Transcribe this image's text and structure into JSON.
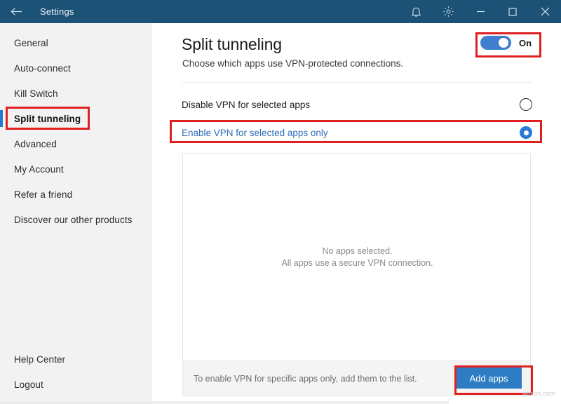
{
  "window": {
    "title": "Settings",
    "back_icon": "back-arrow-icon",
    "notifications_icon": "bell-icon",
    "settings_icon": "gear-icon",
    "minimize_icon": "minimize-icon",
    "maximize_icon": "maximize-icon",
    "close_icon": "close-icon",
    "titlebar_color": "#1b5276"
  },
  "sidebar": {
    "items": [
      {
        "label": "General",
        "active": false
      },
      {
        "label": "Auto-connect",
        "active": false
      },
      {
        "label": "Kill Switch",
        "active": false
      },
      {
        "label": "Split tunneling",
        "active": true
      },
      {
        "label": "Advanced",
        "active": false
      },
      {
        "label": "My Account",
        "active": false
      },
      {
        "label": "Refer a friend",
        "active": false
      },
      {
        "label": "Discover our other products",
        "active": false
      }
    ],
    "bottom_items": [
      {
        "label": "Help Center"
      },
      {
        "label": "Logout"
      }
    ],
    "active_indicator_color": "#1f7ad4"
  },
  "main": {
    "title": "Split tunneling",
    "subtitle": "Choose which apps use VPN-protected connections.",
    "toggle": {
      "state_label": "On",
      "enabled": true,
      "on_color": "#3f7fd0"
    },
    "options": [
      {
        "label": "Disable VPN for selected apps",
        "selected": false
      },
      {
        "label": "Enable VPN for selected apps only",
        "selected": true
      }
    ],
    "app_list": {
      "empty_line1": "No apps selected.",
      "empty_line2": "All apps use a secure VPN connection."
    },
    "footer": {
      "hint": "To enable VPN for specific apps only, add them to the list.",
      "add_button_label": "Add apps",
      "add_button_color": "#2e7cc4"
    }
  },
  "annotations": {
    "color": "#e02020",
    "targets": [
      "split-tunneling-toggle",
      "sidebar-item-split-tunneling",
      "option-enable-vpn-selected-apps-only",
      "add-apps-button"
    ]
  },
  "watermark": {
    "text": "wsxdn.com"
  }
}
